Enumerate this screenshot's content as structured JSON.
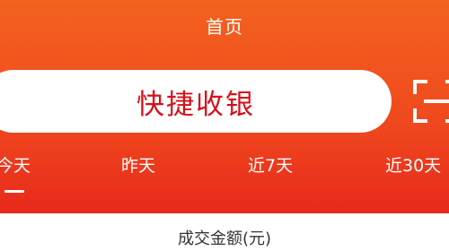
{
  "header": {
    "title": "首页"
  },
  "cashier": {
    "label": "快捷收银"
  },
  "scan": {
    "icon": "scan-icon"
  },
  "tabs": [
    {
      "label": "今天",
      "active": true
    },
    {
      "label": "昨天",
      "active": false
    },
    {
      "label": "近7天",
      "active": false
    },
    {
      "label": "近30天",
      "active": false
    }
  ],
  "metric": {
    "label": "成交金额(元)"
  },
  "colors": {
    "header_top": "#f4621f",
    "header_bottom": "#e8291c",
    "cashier_text": "#d6101a"
  }
}
